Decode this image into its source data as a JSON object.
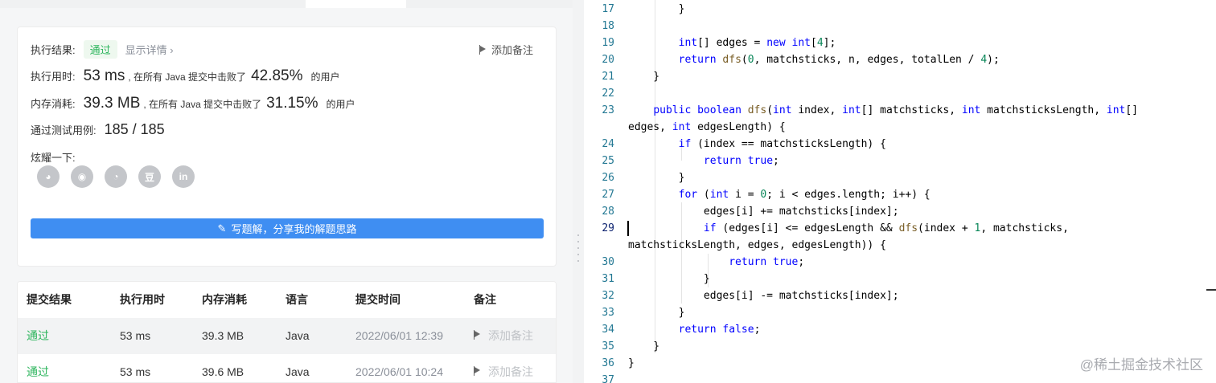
{
  "result": {
    "label_result": "执行结果:",
    "status": "通过",
    "detail_link": "显示详情 ›",
    "add_note": "添加备注",
    "runtime_label": "执行用时:",
    "runtime_value": "53 ms",
    "runtime_text": ", 在所有 Java 提交中击败了",
    "runtime_pct": "42.85%",
    "runtime_suffix": "的用户",
    "memory_label": "内存消耗:",
    "memory_value": "39.3 MB",
    "memory_text": ", 在所有 Java 提交中击败了",
    "memory_pct": "31.15%",
    "memory_suffix": "的用户",
    "tests_label": "通过测试用例:",
    "tests_value": "185 / 185",
    "share_label": "炫耀一下:",
    "social_icons": [
      "wechat-icon",
      "weibo-icon",
      "qq-icon",
      "douban-icon",
      "linkedin-icon"
    ],
    "social_glyphs": [
      "◕",
      "◉",
      "◔",
      "豆",
      "in"
    ],
    "write_button": "写题解，分享我的解题思路"
  },
  "submissions": {
    "headers": [
      "提交结果",
      "执行用时",
      "内存消耗",
      "语言",
      "提交时间",
      "备注"
    ],
    "rows": [
      {
        "status": "通过",
        "runtime": "53 ms",
        "memory": "39.3 MB",
        "lang": "Java",
        "time": "2022/06/01 12:39",
        "note": "添加备注"
      },
      {
        "status": "通过",
        "runtime": "53 ms",
        "memory": "39.6 MB",
        "lang": "Java",
        "time": "2022/06/01 10:24",
        "note": "添加备注"
      }
    ]
  },
  "editor": {
    "line_numbers": [
      "17",
      "18",
      "19",
      "20",
      "21",
      "22",
      "23",
      "",
      "24",
      "25",
      "26",
      "27",
      "28",
      "29",
      "",
      "30",
      "31",
      "32",
      "33",
      "34",
      "35",
      "36",
      "37"
    ],
    "active_line": "29",
    "watermark": "@稀土掘金技术社区"
  },
  "colors": {
    "accent": "#3f8ef2",
    "success": "#2db55d",
    "keyword": "#0000ff",
    "type": "#267f99",
    "function": "#795e26",
    "number": "#098658"
  }
}
